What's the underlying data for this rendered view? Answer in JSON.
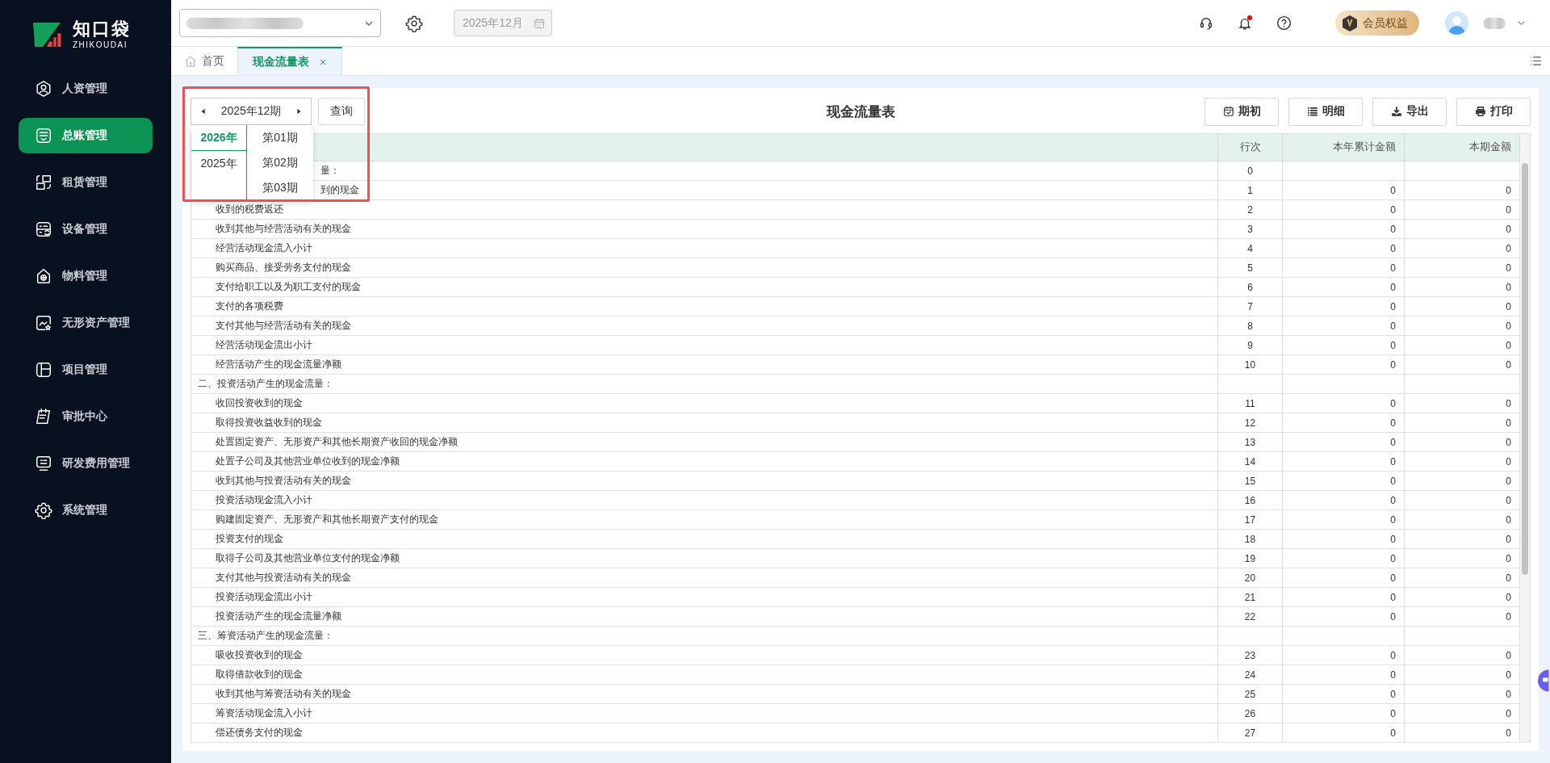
{
  "sidebar": {
    "logo": {
      "name": "知口袋",
      "subtitle": "ZHIKOUDAI"
    },
    "items": [
      {
        "label": "人资管理",
        "selected": false
      },
      {
        "label": "总账管理",
        "selected": true
      },
      {
        "label": "租赁管理",
        "selected": false
      },
      {
        "label": "设备管理",
        "selected": false
      },
      {
        "label": "物料管理",
        "selected": false
      },
      {
        "label": "无形资产管理",
        "selected": false
      },
      {
        "label": "项目管理",
        "selected": false
      },
      {
        "label": "审批中心",
        "selected": false
      },
      {
        "label": "研发费用管理",
        "selected": false
      },
      {
        "label": "系统管理",
        "selected": false
      }
    ]
  },
  "topbar": {
    "date_field": {
      "value": "2025年12月",
      "disabled": true
    },
    "notifications_unread": true,
    "member_button": "会员权益"
  },
  "tabs": [
    {
      "label": "首页",
      "selected": false,
      "closable": false
    },
    {
      "label": "现金流量表",
      "selected": true,
      "closable": true
    }
  ],
  "toolbar": {
    "period": "2025年12期",
    "query_button": "查询",
    "title": "现金流量表",
    "buttons": [
      "期初",
      "明细",
      "导出",
      "打印"
    ]
  },
  "period_dropdown": {
    "highlighted": true,
    "years": [
      {
        "label": "2026年",
        "selected": true
      },
      {
        "label": "2025年",
        "selected": false
      }
    ],
    "periods": [
      {
        "label": "第01期",
        "selected": false
      },
      {
        "label": "第02期",
        "selected": false
      },
      {
        "label": "第03期",
        "selected": false
      }
    ]
  },
  "table": {
    "columns": [
      "行次",
      "本年累计金额",
      "本期金额"
    ],
    "rows": [
      {
        "kind": "section",
        "name": "量：",
        "line": "0"
      },
      {
        "kind": "item",
        "name": "到的现金",
        "line": "1",
        "ytd": "0",
        "period": "0"
      },
      {
        "kind": "item",
        "name": "收到的税费返还",
        "line": "2",
        "ytd": "0",
        "period": "0"
      },
      {
        "kind": "item",
        "name": "收到其他与经营活动有关的现金",
        "line": "3",
        "ytd": "0",
        "period": "0"
      },
      {
        "kind": "item",
        "name": "经营活动现金流入小计",
        "line": "4",
        "ytd": "0",
        "period": "0"
      },
      {
        "kind": "item",
        "name": "购买商品、接受劳务支付的现金",
        "line": "5",
        "ytd": "0",
        "period": "0"
      },
      {
        "kind": "item",
        "name": "支付给职工以及为职工支付的现金",
        "line": "6",
        "ytd": "0",
        "period": "0"
      },
      {
        "kind": "item",
        "name": "支付的各项税费",
        "line": "7",
        "ytd": "0",
        "period": "0"
      },
      {
        "kind": "item",
        "name": "支付其他与经营活动有关的现金",
        "line": "8",
        "ytd": "0",
        "period": "0"
      },
      {
        "kind": "item",
        "name": "经营活动现金流出小计",
        "line": "9",
        "ytd": "0",
        "period": "0"
      },
      {
        "kind": "item",
        "name": "经营活动产生的现金流量净额",
        "line": "10",
        "ytd": "0",
        "period": "0"
      },
      {
        "kind": "section",
        "name": "二、投资活动产生的现金流量："
      },
      {
        "kind": "item",
        "name": "收回投资收到的现金",
        "line": "11",
        "ytd": "0",
        "period": "0"
      },
      {
        "kind": "item",
        "name": "取得投资收益收到的现金",
        "line": "12",
        "ytd": "0",
        "period": "0"
      },
      {
        "kind": "item",
        "name": "处置固定资产、无形资产和其他长期资产收回的现金净额",
        "line": "13",
        "ytd": "0",
        "period": "0"
      },
      {
        "kind": "item",
        "name": "处置子公司及其他营业单位收到的现金净额",
        "line": "14",
        "ytd": "0",
        "period": "0"
      },
      {
        "kind": "item",
        "name": "收到其他与投资活动有关的现金",
        "line": "15",
        "ytd": "0",
        "period": "0"
      },
      {
        "kind": "item",
        "name": "投资活动现金流入小计",
        "line": "16",
        "ytd": "0",
        "period": "0"
      },
      {
        "kind": "item",
        "name": "购建固定资产、无形资产和其他长期资产支付的现金",
        "line": "17",
        "ytd": "0",
        "period": "0"
      },
      {
        "kind": "item",
        "name": "投资支付的现金",
        "line": "18",
        "ytd": "0",
        "period": "0"
      },
      {
        "kind": "item",
        "name": "取得子公司及其他营业单位支付的现金净额",
        "line": "19",
        "ytd": "0",
        "period": "0"
      },
      {
        "kind": "item",
        "name": "支付其他与投资活动有关的现金",
        "line": "20",
        "ytd": "0",
        "period": "0"
      },
      {
        "kind": "item",
        "name": "投资活动现金流出小计",
        "line": "21",
        "ytd": "0",
        "period": "0"
      },
      {
        "kind": "item",
        "name": "投资活动产生的现金流量净额",
        "line": "22",
        "ytd": "0",
        "period": "0"
      },
      {
        "kind": "section",
        "name": "三、筹资活动产生的现金流量："
      },
      {
        "kind": "item",
        "name": "吸收投资收到的现金",
        "line": "23",
        "ytd": "0",
        "period": "0"
      },
      {
        "kind": "item",
        "name": "取得借款收到的现金",
        "line": "24",
        "ytd": "0",
        "period": "0"
      },
      {
        "kind": "item",
        "name": "收到其他与筹资活动有关的现金",
        "line": "25",
        "ytd": "0",
        "period": "0"
      },
      {
        "kind": "item",
        "name": "筹资活动现金流入小计",
        "line": "26",
        "ytd": "0",
        "period": "0"
      },
      {
        "kind": "item",
        "name": "偿还债务支付的现金",
        "line": "27",
        "ytd": "0",
        "period": "0"
      }
    ]
  }
}
